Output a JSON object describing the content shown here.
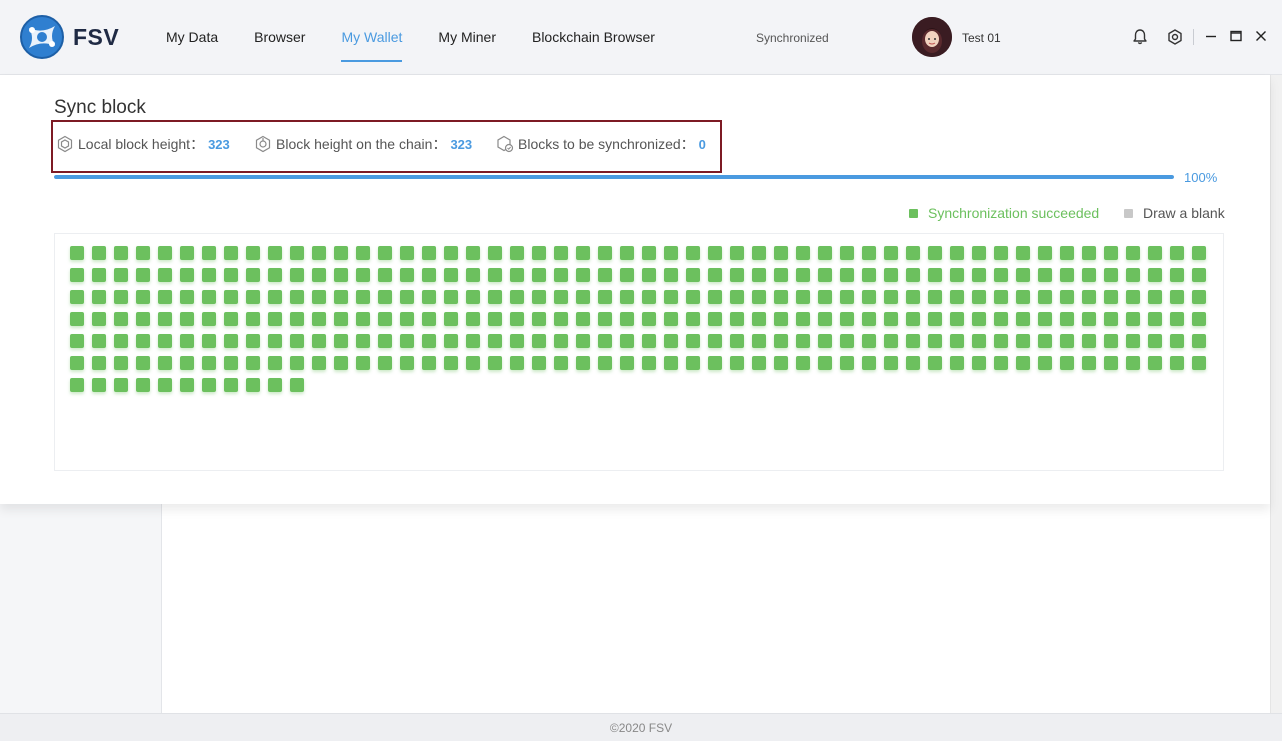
{
  "app": {
    "brand": "FSV",
    "sync_status": "Synchronized",
    "username": "Test 01",
    "footer": "©2020 FSV"
  },
  "nav": {
    "items": [
      {
        "label": "My Data",
        "active": false
      },
      {
        "label": "Browser",
        "active": false
      },
      {
        "label": "My Wallet",
        "active": true
      },
      {
        "label": "My Miner",
        "active": false
      },
      {
        "label": "Blockchain Browser",
        "active": false
      }
    ]
  },
  "header_icons": [
    "bell-icon",
    "settings-hex-icon",
    "minimize-icon",
    "maximize-icon",
    "close-icon"
  ],
  "sync": {
    "title": "Sync block",
    "local_label": "Local block height：",
    "local_value": "323",
    "chain_label": "Block height on the chain：",
    "chain_value": "323",
    "pending_label": "Blocks to be synchronized：",
    "pending_value": "0",
    "progress_percent": 100,
    "progress_text": "100%",
    "legend_success": "Synchronization succeeded",
    "legend_blank": "Draw a blank",
    "blocks_synced": 323,
    "blocks_blank": 0
  },
  "colors": {
    "accent": "#4a9ae0",
    "success": "#6cc05e",
    "blank": "#c8c8c8",
    "highlight_border": "#7d1a24"
  }
}
